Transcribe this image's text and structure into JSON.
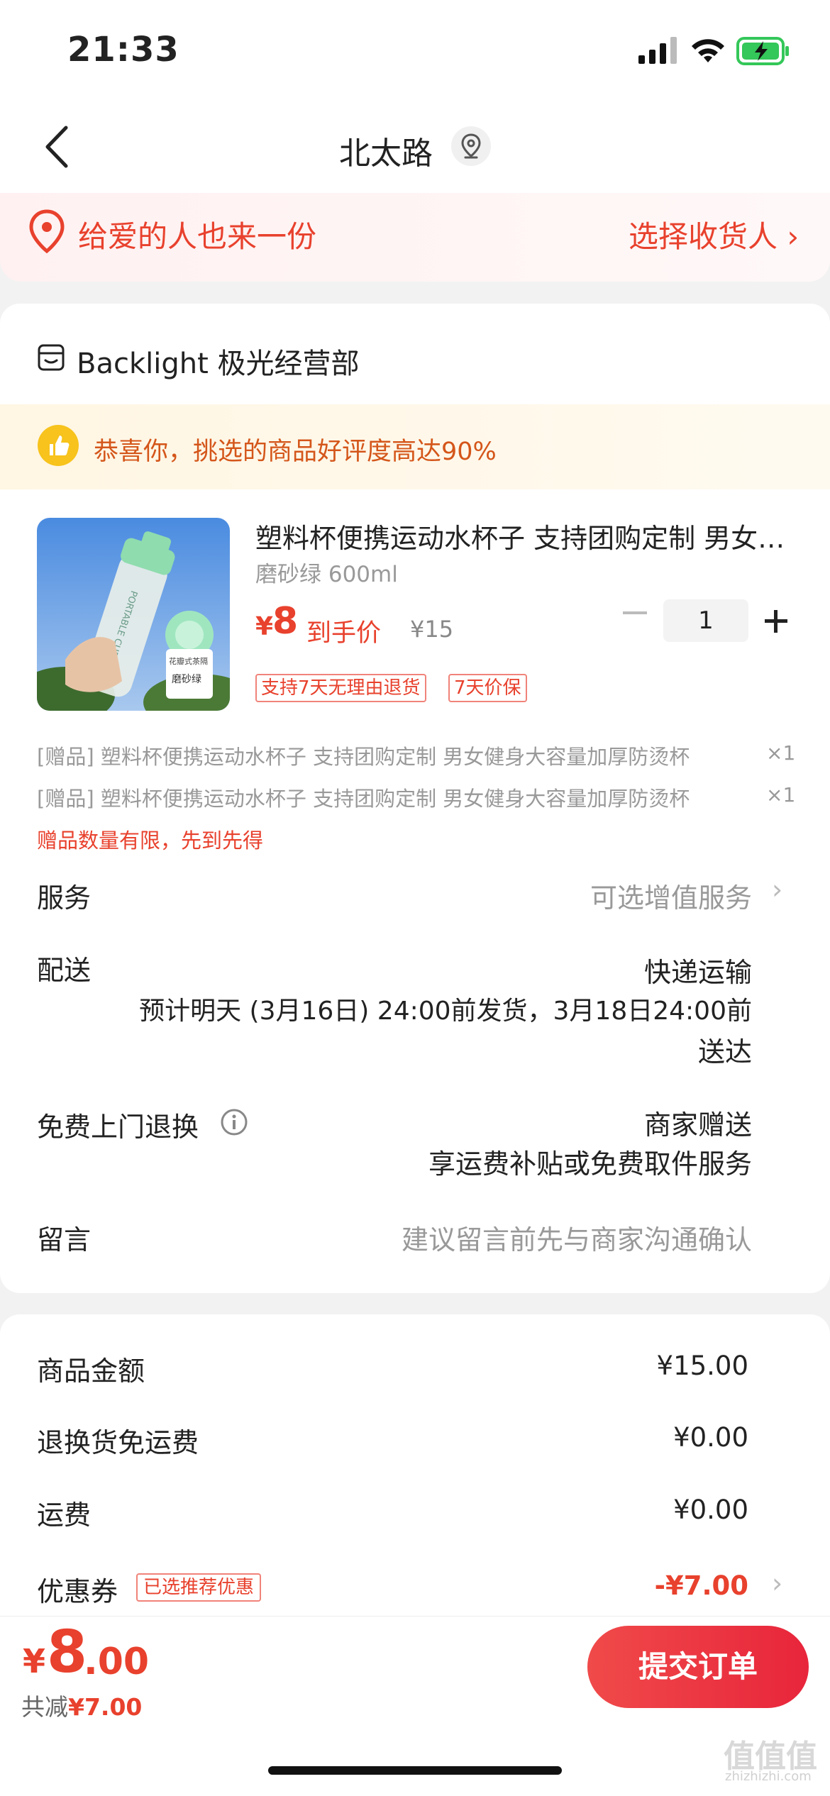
{
  "status_bar": {
    "time": "21:33"
  },
  "nav": {
    "title": "北太路"
  },
  "gift_banner": {
    "text": "给爱的人也来一份",
    "action": "选择收货人 ›"
  },
  "shop": {
    "name": "Backlight 极光经营部"
  },
  "praise": {
    "text": "恭喜你，挑选的商品好评度高达90%"
  },
  "product": {
    "title": "塑料杯便携运动水杯子 支持团购定制 男女健身大容量加厚防烫",
    "spec": "磨砂绿 600ml",
    "price_currency": "¥",
    "price": "8",
    "price_label": "到手价",
    "original_price": "¥15",
    "quantity": "1",
    "tags": [
      "支持7天无理由退货",
      "7天价保"
    ],
    "image_text": {
      "cup": "PORTABLE CUP",
      "lid": "花瓣式茶隔",
      "color": "磨砂绿"
    }
  },
  "gifts": [
    {
      "text": "[赠品] 塑料杯便携运动水杯子 支持团购定制 男女健身大容量加厚防烫杯",
      "qty": "×1"
    },
    {
      "text": "[赠品] 塑料杯便携运动水杯子 支持团购定制 男女健身大容量加厚防烫杯",
      "qty": "×1"
    }
  ],
  "gift_limit": "赠品数量有限，先到先得",
  "rows": {
    "service_label": "服务",
    "service_value": "可选增值服务",
    "delivery_label": "配送",
    "delivery_method": "快递运输",
    "delivery_line1": "预计明天 (3月16日) 24:00前发货，3月18日24:00前",
    "delivery_line2": "送达",
    "return_label": "免费上门退换",
    "return_value1": "商家赠送",
    "return_value2": "享运费补贴或免费取件服务",
    "message_label": "留言",
    "message_placeholder": "建议留言前先与商家沟通确认"
  },
  "summary": {
    "goods_label": "商品金额",
    "goods_value": "¥15.00",
    "return_fee_label": "退换货免运费",
    "return_fee_value": "¥0.00",
    "shipping_label": "运费",
    "shipping_value": "¥0.00",
    "coupon_label": "优惠券",
    "coupon_tag": "已选推荐优惠",
    "coupon_value": "-¥7.00"
  },
  "bottom": {
    "currency": "¥",
    "total_int": "8",
    "total_dec": ".00",
    "saved_label": "共减",
    "saved_value": "¥7.00",
    "submit_label": "提交订单"
  },
  "watermark": {
    "main": "值值值",
    "sub": "zhizhizhi.com"
  },
  "colors": {
    "accent": "#e8412d",
    "praise": "#d4561a",
    "submit": "#e8253b"
  }
}
